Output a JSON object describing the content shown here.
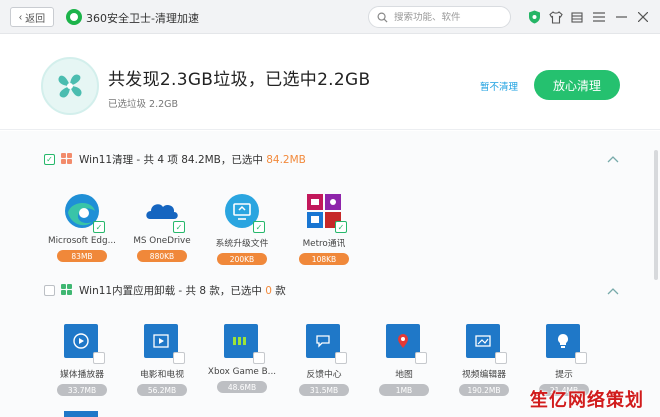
{
  "titlebar": {
    "back_label": "返回",
    "app_title": "360安全卫士-清理加速",
    "search_placeholder": "搜索功能、软件",
    "icons": [
      "shield-icon",
      "clothes-icon",
      "calendar-icon",
      "menu-icon",
      "minimize-icon",
      "close-icon"
    ]
  },
  "summary": {
    "headline": "共发现2.3GB垃圾，已选中2.2GB",
    "subline": "已选垃圾 2.2GB",
    "pause_label": "暂不清理",
    "clean_label": "放心清理"
  },
  "sections": [
    {
      "title_prefix": "Win11清理 - 共 4 项 84.2MB，已选中 ",
      "title_highlight": "84.2MB",
      "title_suffix": "",
      "items": [
        {
          "label": "Microsoft Edg...",
          "size": "83MB",
          "icon": "edge-icon"
        },
        {
          "label": "MS OneDrive",
          "size": "880KB",
          "icon": "onedrive-icon"
        },
        {
          "label": "系统升级文件",
          "size": "200KB",
          "icon": "system-upgrade-icon"
        },
        {
          "label": "Metro通讯",
          "size": "108KB",
          "icon": "metro-icon"
        }
      ]
    },
    {
      "title_prefix": "Win11内置应用卸载 - 共 8 款，已选中 ",
      "title_highlight": "0",
      "title_suffix": " 款",
      "items": [
        {
          "label": "媒体播放器",
          "size": "33.7MB",
          "icon": "media-player-icon"
        },
        {
          "label": "电影和电视",
          "size": "56.2MB",
          "icon": "movies-tv-icon"
        },
        {
          "label": "Xbox Game B...",
          "size": "48.6MB",
          "icon": "xbox-icon"
        },
        {
          "label": "反馈中心",
          "size": "31.5MB",
          "icon": "feedback-icon"
        },
        {
          "label": "地图",
          "size": "1MB",
          "icon": "maps-icon"
        },
        {
          "label": "视频编辑器",
          "size": "190.2MB",
          "icon": "video-editor-icon"
        },
        {
          "label": "提示",
          "size": "21.4MB",
          "icon": "tips-icon"
        }
      ]
    }
  ],
  "colors": {
    "accent_green": "#25c16f",
    "size_orange": "#f0883a",
    "link_blue": "#1a9fe0",
    "tile_blue": "#1f78c8"
  },
  "watermark": "笙亿网络策划"
}
